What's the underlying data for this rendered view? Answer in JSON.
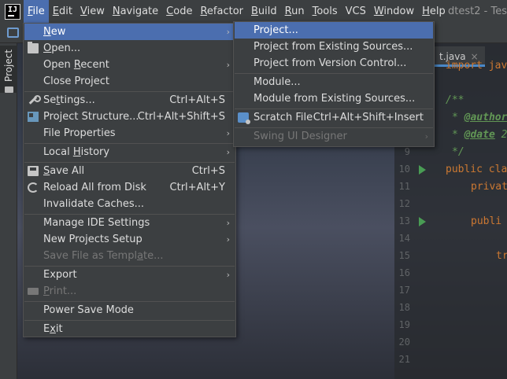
{
  "window_title": "dtest2 - Tes",
  "menubar": {
    "items": [
      {
        "label": "File",
        "u": "F",
        "rest": "ile"
      },
      {
        "label": "Edit",
        "u": "E",
        "rest": "dit"
      },
      {
        "label": "View",
        "u": "V",
        "rest": "iew"
      },
      {
        "label": "Navigate",
        "u": "N",
        "rest": "avigate"
      },
      {
        "label": "Code",
        "u": "C",
        "rest": "ode"
      },
      {
        "label": "Refactor",
        "u": "R",
        "rest": "efactor"
      },
      {
        "label": "Build",
        "u": "B",
        "rest": "uild"
      },
      {
        "label": "Run",
        "u": "R",
        "rest": "un"
      },
      {
        "label": "Tools",
        "u": "T",
        "rest": "ools"
      },
      {
        "label": "VCS",
        "u": "",
        "rest": "VCS"
      },
      {
        "label": "Window",
        "u": "W",
        "rest": "indow"
      },
      {
        "label": "Help",
        "u": "H",
        "rest": "elp"
      }
    ]
  },
  "tool_strip": {
    "project_label": "Project"
  },
  "editor": {
    "tab_label": "t.java",
    "tab_close": "×",
    "line_numbers": [
      "9",
      "10",
      "11",
      "12",
      "13",
      "14",
      "15",
      "16",
      "17",
      "18",
      "19",
      "20",
      "21"
    ],
    "code": {
      "import_line": "import jav",
      "doc_open": "/**",
      "author_star": "* ",
      "author_tag": "@author",
      "date_star": "* ",
      "date_tag": "@date",
      "date_rest": " 2",
      "doc_close": "*/",
      "public_kw": "public",
      "public_rest": " cla",
      "private_kw": "privat",
      "public2_kw": "publi",
      "tr": "tr"
    }
  },
  "file_menu": {
    "items": [
      {
        "pre": "",
        "u": "N",
        "post": "ew",
        "shortcut": "",
        "arrow": "›"
      },
      {
        "pre": "",
        "u": "O",
        "post": "pen...",
        "shortcut": "",
        "arrow": ""
      },
      {
        "pre": "Open ",
        "u": "R",
        "post": "ecent",
        "shortcut": "",
        "arrow": "›"
      },
      {
        "pre": "Close Project",
        "u": "",
        "post": "",
        "shortcut": "",
        "arrow": ""
      },
      {
        "pre": "Se",
        "u": "t",
        "post": "tings...",
        "shortcut": "Ctrl+Alt+S",
        "arrow": ""
      },
      {
        "pre": "Project Structure...",
        "u": "",
        "post": "",
        "shortcut": "Ctrl+Alt+Shift+S",
        "arrow": ""
      },
      {
        "pre": "File Properties",
        "u": "",
        "post": "",
        "shortcut": "",
        "arrow": "›"
      },
      {
        "pre": "Local ",
        "u": "H",
        "post": "istory",
        "shortcut": "",
        "arrow": "›"
      },
      {
        "pre": "",
        "u": "S",
        "post": "ave All",
        "shortcut": "Ctrl+S",
        "arrow": ""
      },
      {
        "pre": "Reload All from Disk",
        "u": "",
        "post": "",
        "shortcut": "Ctrl+Alt+Y",
        "arrow": ""
      },
      {
        "pre": "Invalidate Caches...",
        "u": "",
        "post": "",
        "shortcut": "",
        "arrow": ""
      },
      {
        "pre": "Manage IDE Settings",
        "u": "",
        "post": "",
        "shortcut": "",
        "arrow": "›"
      },
      {
        "pre": "New Projects Setup",
        "u": "",
        "post": "",
        "shortcut": "",
        "arrow": "›"
      },
      {
        "pre": "Save File as Templ",
        "u": "a",
        "post": "te...",
        "shortcut": "",
        "arrow": ""
      },
      {
        "pre": "Export",
        "u": "",
        "post": "",
        "shortcut": "",
        "arrow": "›"
      },
      {
        "pre": "",
        "u": "P",
        "post": "rint...",
        "shortcut": "",
        "arrow": ""
      },
      {
        "pre": "Power Save Mode",
        "u": "",
        "post": "",
        "shortcut": "",
        "arrow": ""
      },
      {
        "pre": "E",
        "u": "x",
        "post": "it",
        "shortcut": "",
        "arrow": ""
      }
    ]
  },
  "new_submenu": {
    "items": [
      {
        "label": "Project...",
        "shortcut": "",
        "arrow": ""
      },
      {
        "label": "Project from Existing Sources...",
        "shortcut": "",
        "arrow": ""
      },
      {
        "label": "Project from Version Control...",
        "shortcut": "",
        "arrow": ""
      },
      {
        "label": "Module...",
        "shortcut": "",
        "arrow": ""
      },
      {
        "label": "Module from Existing Sources...",
        "shortcut": "",
        "arrow": ""
      },
      {
        "label": "Scratch File",
        "shortcut": "Ctrl+Alt+Shift+Insert",
        "arrow": ""
      },
      {
        "label": "Swing UI Designer",
        "shortcut": "",
        "arrow": "›"
      }
    ]
  },
  "colors": {
    "selection": "#4b6eaf",
    "menu_bg": "#3c3f41",
    "disabled_text": "#777777",
    "run_arrow": "#499c54"
  },
  "icons": {
    "open": "folder-icon",
    "settings": "wrench-icon",
    "project_structure": "project-structure-icon",
    "save_all": "save-icon",
    "reload": "reload-icon",
    "print": "printer-icon",
    "scratch_file": "scratch-file-icon"
  }
}
